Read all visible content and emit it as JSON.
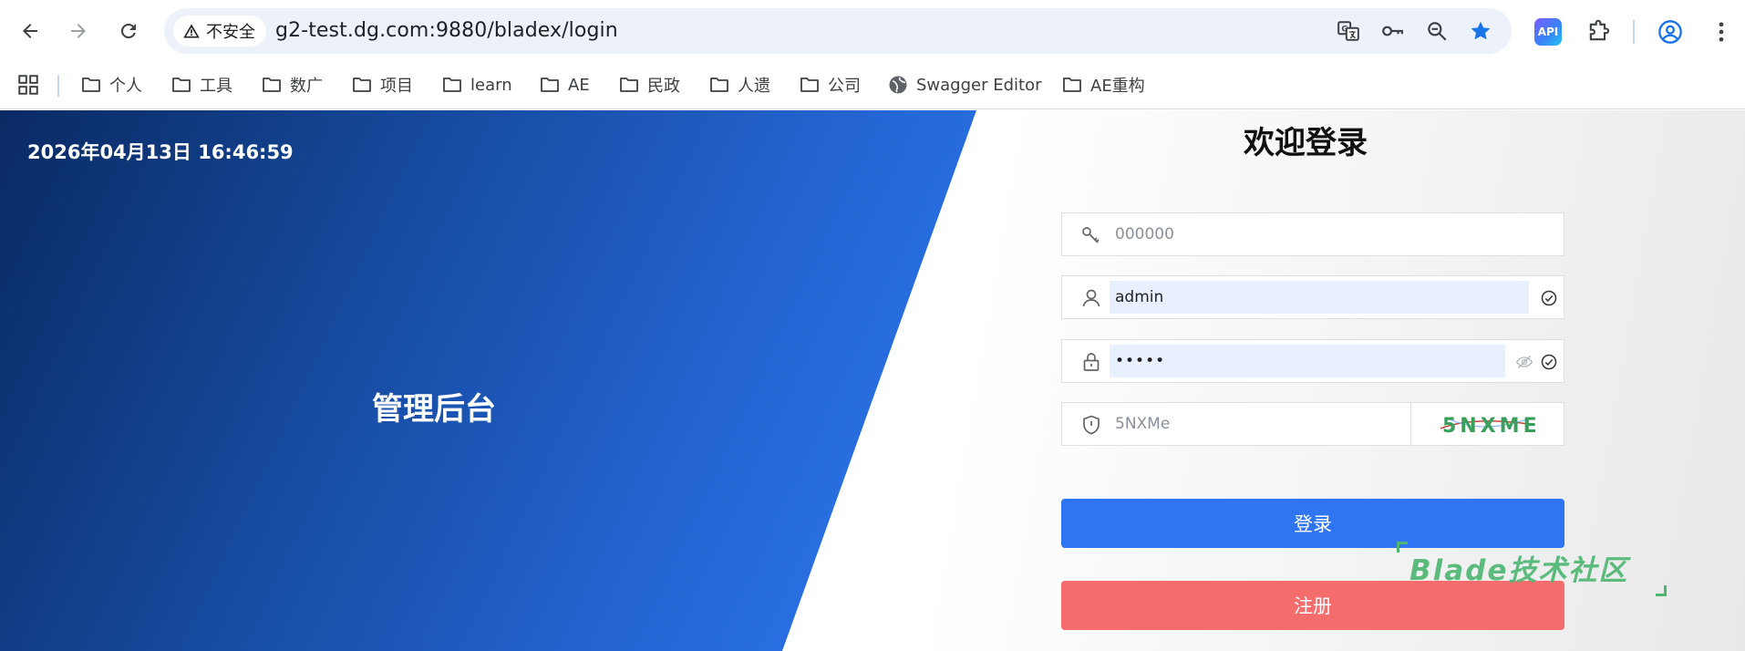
{
  "browser": {
    "security_label": "不安全",
    "url": "g2-test.dg.com:9880/bladex/login",
    "ext_api_label": "API"
  },
  "bookmarks": [
    {
      "label": "个人"
    },
    {
      "label": "工具"
    },
    {
      "label": "数广"
    },
    {
      "label": "项目"
    },
    {
      "label": "learn"
    },
    {
      "label": "AE"
    },
    {
      "label": "民政"
    },
    {
      "label": "人遗"
    },
    {
      "label": "公司"
    },
    {
      "label": "Swagger Editor"
    },
    {
      "label": "AE重构"
    }
  ],
  "hero": {
    "datetime": "2026年04月13日 16:46:59",
    "title": "管理后台"
  },
  "login": {
    "title": "欢迎登录",
    "tenant_placeholder": "000000",
    "username_value": "admin",
    "password_value": "•••••",
    "captcha_value": "5NXMe",
    "captcha_image_text": "5NXME",
    "login_button": "登录",
    "register_button": "注册"
  },
  "watermark": {
    "text": "Blade技术社区"
  },
  "colors": {
    "primary": "#2f74f0",
    "danger": "#f46c6c",
    "hero_dark": "#0a2a63",
    "hero_light": "#2f7bf2",
    "watermark": "#4fb774"
  }
}
